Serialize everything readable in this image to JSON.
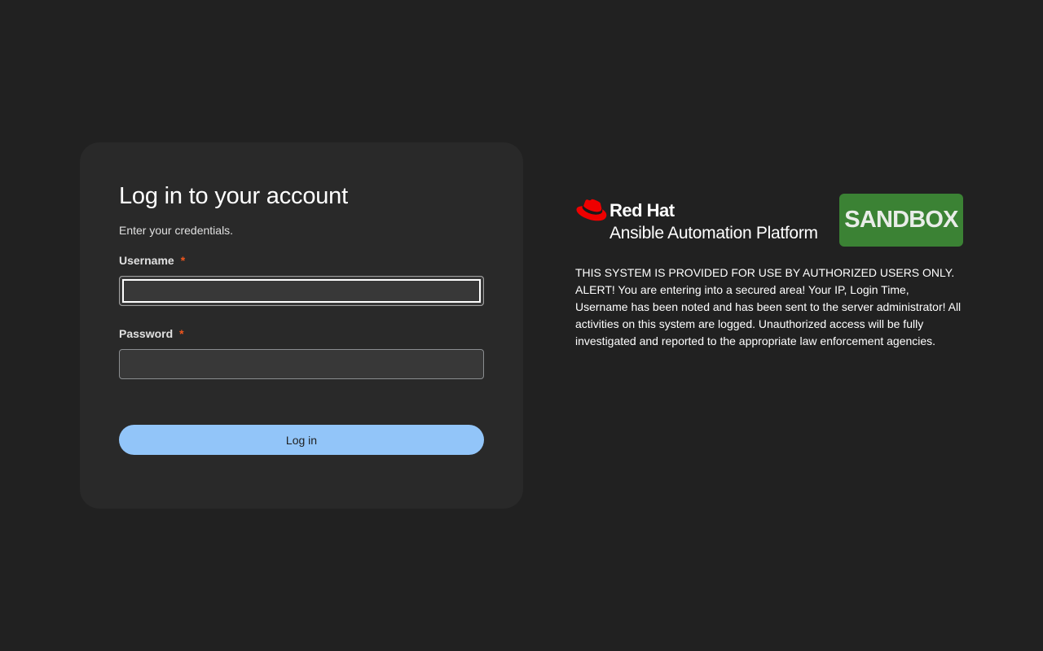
{
  "login": {
    "title": "Log in to your account",
    "subtitle": "Enter your credentials.",
    "username": {
      "label": "Username",
      "required_marker": "*",
      "value": "",
      "placeholder": ""
    },
    "password": {
      "label": "Password",
      "required_marker": "*",
      "value": "",
      "placeholder": ""
    },
    "submit_label": "Log in"
  },
  "brand": {
    "company": "Red Hat",
    "product": "Ansible Automation Platform",
    "logo_icon": "red-hat-icon",
    "badge_text": "SANDBOX",
    "badge_color": "#3b8234"
  },
  "notice": {
    "text": "THIS SYSTEM IS PROVIDED FOR USE BY AUTHORIZED USERS ONLY. ALERT! You are entering into a secured area! Your IP, Login Time, Username has been noted and has been sent to the server administrator! All activities on this system are logged. Unauthorized access will be fully investigated and reported to the appropriate law enforcement agencies."
  },
  "colors": {
    "background": "#212121",
    "card": "#292929",
    "primary_button": "#92c5f9",
    "required": "#f0561d",
    "brand_red": "#ee0000"
  }
}
